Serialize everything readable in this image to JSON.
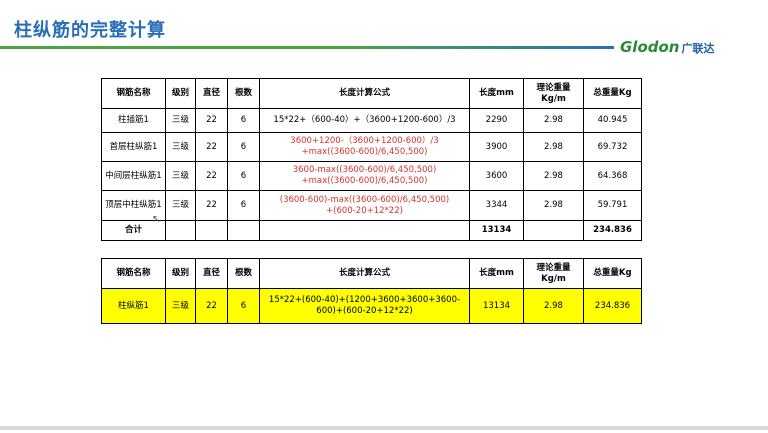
{
  "page": {
    "title": "柱纵筋的完整计算",
    "logo_en": "Glodon",
    "logo_cn": "广联达"
  },
  "headers": [
    "钢筋名称",
    "级别",
    "直径",
    "根数",
    "长度计算公式",
    "长度mm",
    "理论重量Kg/m",
    "总重量Kg"
  ],
  "table1": {
    "rows": [
      {
        "name": "柱插筋1",
        "grade": "三级",
        "diameter": "22",
        "count": "6",
        "formula_lines": [
          "15*22+（600-40）+（3600+1200-600）/3"
        ],
        "formula_color": "black",
        "length": "2290",
        "unit_weight": "2.98",
        "total_weight": "40.945"
      },
      {
        "name": "首层柱纵筋1",
        "grade": "三级",
        "diameter": "22",
        "count": "6",
        "formula_lines": [
          "3600+1200-（3600+1200-600）/3",
          "+max((3600-600)/6,450,500)"
        ],
        "formula_color": "red",
        "length": "3900",
        "unit_weight": "2.98",
        "total_weight": "69.732"
      },
      {
        "name": "中间层柱纵筋1",
        "grade": "三级",
        "diameter": "22",
        "count": "6",
        "formula_lines": [
          "3600-max((3600-600)/6,450,500)",
          "+max((3600-600)/6,450,500)"
        ],
        "formula_color": "red",
        "length": "3600",
        "unit_weight": "2.98",
        "total_weight": "64.368"
      },
      {
        "name": "顶层中柱纵筋1",
        "grade": "三级",
        "diameter": "22",
        "count": "6",
        "formula_lines": [
          "(3600-600)-max((3600-600)/6,450,500)",
          "+(600-20+12*22)"
        ],
        "formula_color": "red",
        "length": "3344",
        "unit_weight": "2.98",
        "total_weight": "59.791"
      }
    ],
    "total": {
      "label": "合计",
      "length": "13134",
      "total_weight": "234.836"
    }
  },
  "table2": {
    "rows": [
      {
        "name": "柱纵筋1",
        "grade": "三级",
        "diameter": "22",
        "count": "6",
        "formula_lines": [
          "15*22+(600-40)+(1200+3600+3600+3600-",
          "600)+(600-20+12*22)"
        ],
        "length": "13134",
        "unit_weight": "2.98",
        "total_weight": "234.836"
      }
    ]
  },
  "colors": {
    "title": "#2a6fb6",
    "formula_red": "#d2352b",
    "highlight": "#ffff00",
    "logo_green": "#2a8a3c"
  }
}
